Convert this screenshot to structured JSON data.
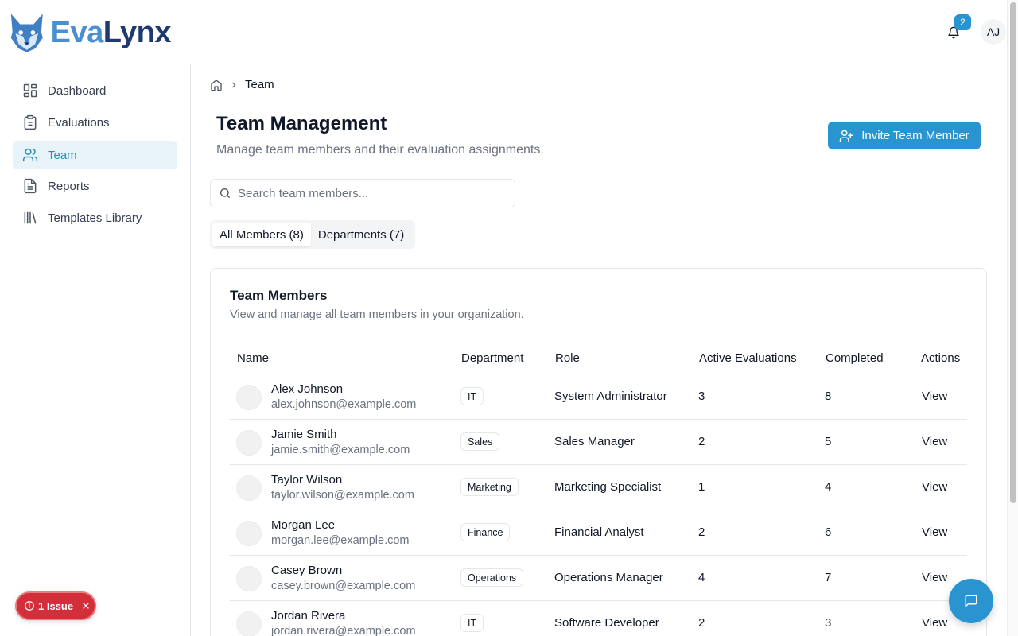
{
  "app": {
    "name_part1": "Eva",
    "name_part2": "Lynx"
  },
  "header": {
    "notification_count": "2",
    "user_initials": "AJ"
  },
  "sidebar": {
    "items": [
      {
        "label": "Dashboard",
        "icon": "dashboard-icon"
      },
      {
        "label": "Evaluations",
        "icon": "clipboard-icon"
      },
      {
        "label": "Team",
        "icon": "users-icon",
        "active": true
      },
      {
        "label": "Reports",
        "icon": "file-text-icon"
      },
      {
        "label": "Templates Library",
        "icon": "library-icon"
      }
    ]
  },
  "breadcrumb": {
    "current": "Team"
  },
  "page": {
    "title": "Team Management",
    "subtitle": "Manage team members and their evaluation assignments.",
    "invite_label": "Invite Team Member"
  },
  "search": {
    "placeholder": "Search team members...",
    "value": ""
  },
  "tabs": [
    {
      "label": "All Members (8)",
      "active": true
    },
    {
      "label": "Departments (7)",
      "active": false
    }
  ],
  "card": {
    "title": "Team Members",
    "subtitle": "View and manage all team members in your organization."
  },
  "table": {
    "columns": [
      "Name",
      "Department",
      "Role",
      "Active Evaluations",
      "Completed",
      "Actions"
    ],
    "rows": [
      {
        "name": "Alex Johnson",
        "email": "alex.johnson@example.com",
        "department": "IT",
        "role": "System Administrator",
        "active": "3",
        "completed": "8",
        "action": "View"
      },
      {
        "name": "Jamie Smith",
        "email": "jamie.smith@example.com",
        "department": "Sales",
        "role": "Sales Manager",
        "active": "2",
        "completed": "5",
        "action": "View"
      },
      {
        "name": "Taylor Wilson",
        "email": "taylor.wilson@example.com",
        "department": "Marketing",
        "role": "Marketing Specialist",
        "active": "1",
        "completed": "4",
        "action": "View"
      },
      {
        "name": "Morgan Lee",
        "email": "morgan.lee@example.com",
        "department": "Finance",
        "role": "Financial Analyst",
        "active": "2",
        "completed": "6",
        "action": "View"
      },
      {
        "name": "Casey Brown",
        "email": "casey.brown@example.com",
        "department": "Operations",
        "role": "Operations Manager",
        "active": "4",
        "completed": "7",
        "action": "View"
      },
      {
        "name": "Jordan Rivera",
        "email": "jordan.rivera@example.com",
        "department": "IT",
        "role": "Software Developer",
        "active": "2",
        "completed": "3",
        "action": "View"
      }
    ]
  },
  "issue_badge": {
    "label": "1 Issue"
  },
  "colors": {
    "accent": "#2a94d1",
    "active_nav_bg": "#e7f3f8",
    "issue_red": "#d32f3a"
  }
}
